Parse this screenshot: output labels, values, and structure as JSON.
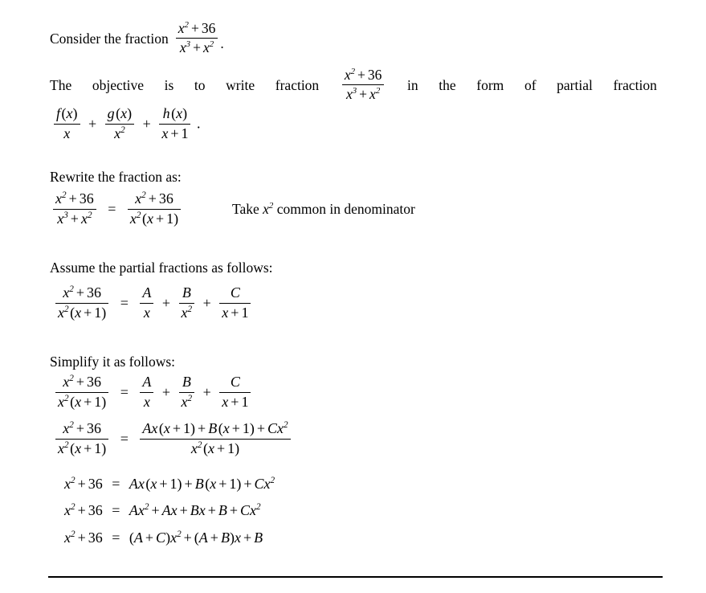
{
  "document": {
    "type": "math-worksheet",
    "topic": "Partial fraction decomposition",
    "background_color": "#ffffff",
    "text_color": "#000000"
  },
  "intro": {
    "lead_text": "Consider the fraction",
    "fraction": {
      "numerator": "x2 + 36",
      "denominator": "x3 + x2"
    },
    "trailing_punctuation": "."
  },
  "objective": {
    "segment_1": "The",
    "segment_2": "objective",
    "segment_3": "is",
    "segment_4": "to",
    "segment_5": "write",
    "segment_6": "fraction",
    "fraction": {
      "numerator": "x2 + 36",
      "denominator": "x3 + x2"
    },
    "segment_7": "in",
    "segment_8": "the",
    "segment_9": "form",
    "segment_10": "of",
    "segment_11": "partial",
    "segment_12": "fraction"
  },
  "target_form": {
    "term_1": {
      "numerator": "f(x)",
      "denominator": "x"
    },
    "plus_1": "+",
    "term_2": {
      "numerator": "g(x)",
      "denominator": "x2"
    },
    "plus_2": "+",
    "term_3": {
      "numerator": "h(x)",
      "denominator": "x+1"
    },
    "trailing_punctuation": "."
  },
  "step_rewrite": {
    "label": "Rewrite the fraction as:",
    "equation": {
      "left": {
        "numerator": "x2 + 36",
        "denominator": "x3 + x2"
      },
      "relation": "=",
      "right": {
        "numerator": "x2 + 36",
        "denominator": "x2 (x+1)"
      }
    },
    "annotation": {
      "prefix": "Take",
      "variable": "x2",
      "suffix": "common in denominator"
    }
  },
  "step_assume": {
    "label": "Assume the partial fractions as follows:",
    "equation": {
      "left": {
        "numerator": "x2 + 36",
        "denominator": "x2 (x+1)"
      },
      "relation": "=",
      "term_1": {
        "numerator": "A",
        "denominator": "x"
      },
      "plus_1": "+",
      "term_2": {
        "numerator": "B",
        "denominator": "x2"
      },
      "plus_2": "+",
      "term_3": {
        "numerator": "C",
        "denominator": "x+1"
      }
    }
  },
  "step_simplify": {
    "label": "Simplify it as follows:",
    "equation_1": {
      "left": {
        "numerator": "x2 + 36",
        "denominator": "x2 (x+1)"
      },
      "relation": "=",
      "term_1": {
        "numerator": "A",
        "denominator": "x"
      },
      "plus_1": "+",
      "term_2": {
        "numerator": "B",
        "denominator": "x2"
      },
      "plus_2": "+",
      "term_3": {
        "numerator": "C",
        "denominator": "x+1"
      }
    },
    "equation_2": {
      "left": {
        "numerator": "x2 + 36",
        "denominator": "x2 (x+1)"
      },
      "relation": "=",
      "right": {
        "numerator": "Ax(x+1) + B(x+1) + Cx2",
        "denominator": "x2 (x+1)"
      }
    },
    "equation_3": {
      "left": "x2 + 36",
      "relation": "=",
      "right": "Ax(x+1) + B(x+1) + Cx2"
    },
    "equation_4": {
      "left": "x2 + 36",
      "relation": "=",
      "right": "Ax2 + Ax + Bx + B + Cx2"
    },
    "equation_5": {
      "left": "x2 + 36",
      "relation": "=",
      "right": "(A+C)x2 + (A+B)x + B"
    }
  },
  "footer": {
    "has_horizontal_rule": true,
    "rule_color": "#000000"
  }
}
